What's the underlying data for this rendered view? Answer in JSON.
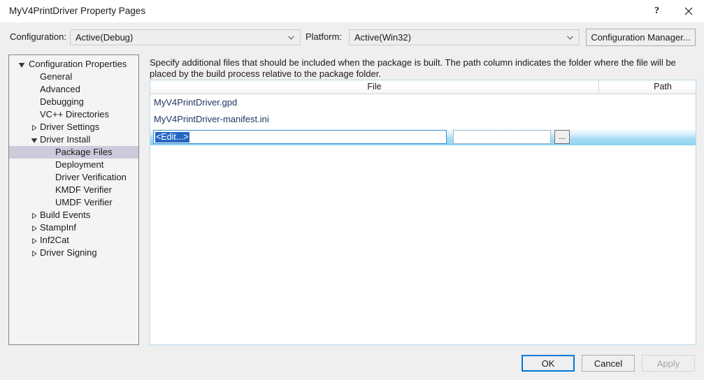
{
  "window": {
    "title": "MyV4PrintDriver Property Pages",
    "help_label": "?",
    "close_label": "✕"
  },
  "configbar": {
    "configuration_label": "Configuration:",
    "configuration_value": "Active(Debug)",
    "platform_label": "Platform:",
    "platform_value": "Active(Win32)",
    "config_manager_label": "Configuration Manager..."
  },
  "tree": {
    "items": [
      {
        "label": "Configuration Properties",
        "indent": 0,
        "twisty": "expanded",
        "selected": false
      },
      {
        "label": "General",
        "indent": 1,
        "twisty": "none",
        "selected": false
      },
      {
        "label": "Advanced",
        "indent": 1,
        "twisty": "none",
        "selected": false
      },
      {
        "label": "Debugging",
        "indent": 1,
        "twisty": "none",
        "selected": false
      },
      {
        "label": "VC++ Directories",
        "indent": 1,
        "twisty": "none",
        "selected": false
      },
      {
        "label": "Driver Settings",
        "indent": 1,
        "twisty": "collapsed",
        "selected": false
      },
      {
        "label": "Driver Install",
        "indent": 1,
        "twisty": "expanded",
        "selected": false
      },
      {
        "label": "Package Files",
        "indent": 2,
        "twisty": "none",
        "selected": true
      },
      {
        "label": "Deployment",
        "indent": 2,
        "twisty": "none",
        "selected": false
      },
      {
        "label": "Driver Verification",
        "indent": 2,
        "twisty": "none",
        "selected": false
      },
      {
        "label": "KMDF Verifier",
        "indent": 2,
        "twisty": "none",
        "selected": false
      },
      {
        "label": "UMDF Verifier",
        "indent": 2,
        "twisty": "none",
        "selected": false
      },
      {
        "label": "Build Events",
        "indent": 1,
        "twisty": "collapsed",
        "selected": false
      },
      {
        "label": "StampInf",
        "indent": 1,
        "twisty": "collapsed",
        "selected": false
      },
      {
        "label": "Inf2Cat",
        "indent": 1,
        "twisty": "collapsed",
        "selected": false
      },
      {
        "label": "Driver Signing",
        "indent": 1,
        "twisty": "collapsed",
        "selected": false
      }
    ]
  },
  "main": {
    "description": "Specify additional files that should be included when the package is built.  The path column indicates the folder where the file will be placed by the build process relative to the package folder.",
    "grid": {
      "columns": [
        "File",
        "Path",
        ""
      ],
      "rows": [
        {
          "file": "MyV4PrintDriver.gpd",
          "path": ""
        },
        {
          "file": "MyV4PrintDriver-manifest.ini",
          "path": ""
        }
      ],
      "edit_row": {
        "file_value": "<Edit...>",
        "path_value": "",
        "browse_label": "..."
      }
    }
  },
  "footer": {
    "ok_label": "OK",
    "cancel_label": "Cancel",
    "apply_label": "Apply"
  },
  "colors": {
    "accent": "#0078d7",
    "selection": "#2566c4",
    "link_text": "#1f3864",
    "tree_selection": "#cbcbdc"
  }
}
